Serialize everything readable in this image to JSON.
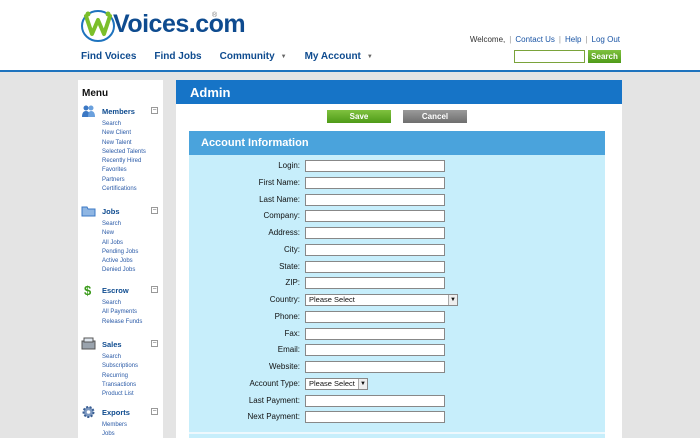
{
  "header": {
    "logo_text": "Voices.com",
    "logo_reg": "®",
    "welcome": "Welcome,",
    "links": [
      "Contact Us",
      "Help",
      "Log Out"
    ],
    "search_placeholder": "",
    "search_button": "Search"
  },
  "mainnav": [
    {
      "label": "Find Voices",
      "caret": ""
    },
    {
      "label": "Find Jobs",
      "caret": ""
    },
    {
      "label": "Community",
      "caret": "▼"
    },
    {
      "label": "My Account",
      "caret": "▼"
    }
  ],
  "sidebar": {
    "title": "Menu",
    "sections": [
      {
        "title": "Members",
        "icon": "members-icon",
        "toggle": "−",
        "items": [
          "Search",
          "New Client",
          "New Talent",
          "Selected Talents",
          "Recently Hired",
          "Favorites",
          "Partners",
          "Certifications"
        ]
      },
      {
        "title": "Jobs",
        "icon": "jobs-folder-icon",
        "toggle": "−",
        "items": [
          "Search",
          "New",
          "All Jobs",
          "Pending Jobs",
          "Active Jobs",
          "Denied Jobs"
        ]
      },
      {
        "title": "Escrow",
        "icon": "dollar-icon",
        "toggle": "−",
        "items": [
          "Search",
          "All Payments",
          "Release Funds"
        ]
      },
      {
        "title": "Sales",
        "icon": "register-icon",
        "toggle": "−",
        "items": [
          "Search",
          "Subscriptions",
          "Recurring",
          "Transactions",
          "Product List"
        ]
      },
      {
        "title": "Exports",
        "icon": "gear-icon",
        "toggle": "−",
        "items": [
          "Members",
          "Jobs"
        ]
      }
    ]
  },
  "content": {
    "title": "Admin",
    "save": "Save",
    "cancel": "Cancel",
    "panel_title": "Account Information",
    "fields": [
      {
        "label": "Login:",
        "type": "text"
      },
      {
        "label": "First Name:",
        "type": "text"
      },
      {
        "label": "Last Name:",
        "type": "text"
      },
      {
        "label": "Company:",
        "type": "text"
      },
      {
        "label": "Address:",
        "type": "text"
      },
      {
        "label": "City:",
        "type": "text"
      },
      {
        "label": "State:",
        "type": "text"
      },
      {
        "label": "ZIP:",
        "type": "text"
      },
      {
        "label": "Country:",
        "type": "select",
        "value": "Please Select",
        "wide": true
      },
      {
        "label": "Phone:",
        "type": "text"
      },
      {
        "label": "Fax:",
        "type": "text"
      },
      {
        "label": "Email:",
        "type": "text"
      },
      {
        "label": "Website:",
        "type": "text"
      },
      {
        "label": "Account Type:",
        "type": "select",
        "value": "Please Select",
        "wide": false
      },
      {
        "label": "Last Payment:",
        "type": "text"
      },
      {
        "label": "Next Payment:",
        "type": "text"
      }
    ]
  },
  "colors": {
    "brand_blue": "#1674c7",
    "panel_bg": "#c7eefb",
    "panel_head": "#4aa3dc",
    "green_button": "#5fa825",
    "logo_green": "#7bbf2a"
  }
}
